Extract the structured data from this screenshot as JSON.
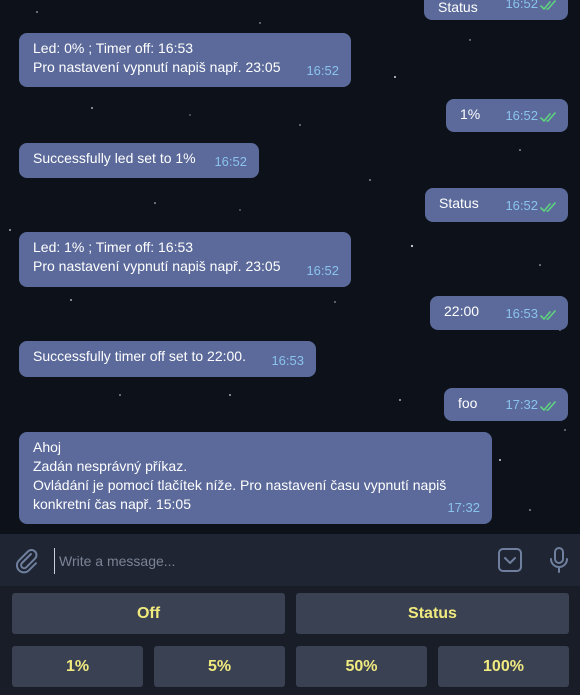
{
  "messages": [
    {
      "text": "Status",
      "time": "16:52",
      "side": "out"
    },
    {
      "text": "Led: 0% ; Timer off: 16:53\nPro nastavení vypnutí napiš např. 23:05",
      "time": "16:52",
      "side": "in"
    },
    {
      "text": "1%",
      "time": "16:52",
      "side": "out"
    },
    {
      "text": "Successfully led set to 1%",
      "time": "16:52",
      "side": "in"
    },
    {
      "text": "Status",
      "time": "16:52",
      "side": "out"
    },
    {
      "text": "Led: 1% ; Timer off: 16:53\nPro nastavení vypnutí napiš např. 23:05",
      "time": "16:52",
      "side": "in"
    },
    {
      "text": "22:00",
      "time": "16:53",
      "side": "out"
    },
    {
      "text": "Successfully timer off set to 22:00.",
      "time": "16:53",
      "side": "in"
    },
    {
      "text": "foo",
      "time": "17:32",
      "side": "out"
    },
    {
      "text": "Ahoj\nZadán nesprávný příkaz.\nOvládání je pomocí tlačítek níže. Pro nastavení času vypnutí napiš\nkonkretní čas např. 15:05",
      "time": "17:32",
      "side": "in"
    }
  ],
  "composer": {
    "placeholder": "Write a message...",
    "attach_icon": "paperclip-icon",
    "emoji_icon": "keyboard-toggle-icon",
    "mic_icon": "microphone-icon"
  },
  "keyboard": {
    "row1": [
      "Off",
      "Status"
    ],
    "row2": [
      "1%",
      "5%",
      "50%",
      "100%"
    ]
  },
  "colors": {
    "bubble": "#5b6a9a",
    "time": "#8bc3ee",
    "read_ticks": "#5ed47e",
    "button_text": "#f1eb7f",
    "button_bg": "#3a4152"
  }
}
